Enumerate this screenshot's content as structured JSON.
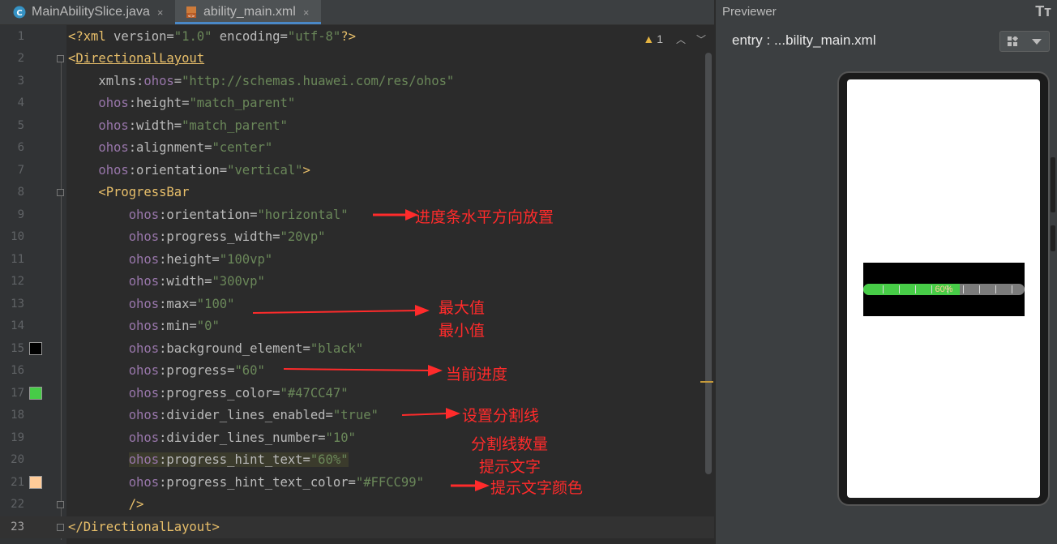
{
  "tabs": [
    {
      "label": "MainAbilitySlice.java",
      "icon": "java-class-icon",
      "close": "×",
      "active": false
    },
    {
      "label": "ability_main.xml",
      "icon": "xml-file-icon",
      "close": "×",
      "active": true
    }
  ],
  "editor": {
    "warning_count": "1",
    "lines": [
      {
        "n": "1",
        "tokens": [
          [
            "punct",
            "<?"
          ],
          [
            "tag",
            "xml "
          ],
          [
            "attr",
            "version"
          ],
          [
            "attr",
            "="
          ],
          [
            "val",
            "\"1.0\""
          ],
          [
            "attr",
            " encoding"
          ],
          [
            "attr",
            "="
          ],
          [
            "val",
            "\"utf-8\""
          ],
          [
            "punct",
            "?>"
          ]
        ]
      },
      {
        "n": "2",
        "tokens": [
          [
            "punct",
            "<"
          ],
          [
            "taglink",
            "DirectionalLayout"
          ]
        ]
      },
      {
        "n": "3",
        "tokens": [
          [
            "attr",
            "    xmlns"
          ],
          [
            "attr",
            ":"
          ],
          [
            "ns",
            "ohos"
          ],
          [
            "attr",
            "="
          ],
          [
            "val",
            "\"http://schemas.huawei.com/res/ohos\""
          ]
        ]
      },
      {
        "n": "4",
        "tokens": [
          [
            "ns",
            "    ohos"
          ],
          [
            "attr",
            ":height="
          ],
          [
            "val",
            "\"match_parent\""
          ]
        ]
      },
      {
        "n": "5",
        "tokens": [
          [
            "ns",
            "    ohos"
          ],
          [
            "attr",
            ":width="
          ],
          [
            "val",
            "\"match_parent\""
          ]
        ]
      },
      {
        "n": "6",
        "tokens": [
          [
            "ns",
            "    ohos"
          ],
          [
            "attr",
            ":alignment="
          ],
          [
            "val",
            "\"center\""
          ]
        ]
      },
      {
        "n": "7",
        "tokens": [
          [
            "ns",
            "    ohos"
          ],
          [
            "attr",
            ":orientation="
          ],
          [
            "val",
            "\"vertical\""
          ],
          [
            "punct",
            ">"
          ]
        ]
      },
      {
        "n": "8",
        "tokens": [
          [
            "punct",
            "    <"
          ],
          [
            "tag",
            "ProgressBar"
          ]
        ]
      },
      {
        "n": "9",
        "tokens": [
          [
            "ns",
            "        ohos"
          ],
          [
            "attr",
            ":orientation="
          ],
          [
            "val",
            "\"horizontal\""
          ]
        ]
      },
      {
        "n": "10",
        "tokens": [
          [
            "ns",
            "        ohos"
          ],
          [
            "attr",
            ":progress_width="
          ],
          [
            "val",
            "\"20vp\""
          ]
        ]
      },
      {
        "n": "11",
        "tokens": [
          [
            "ns",
            "        ohos"
          ],
          [
            "attr",
            ":height="
          ],
          [
            "val",
            "\"100vp\""
          ]
        ]
      },
      {
        "n": "12",
        "tokens": [
          [
            "ns",
            "        ohos"
          ],
          [
            "attr",
            ":width="
          ],
          [
            "val",
            "\"300vp\""
          ]
        ]
      },
      {
        "n": "13",
        "tokens": [
          [
            "ns",
            "        ohos"
          ],
          [
            "attr",
            ":max="
          ],
          [
            "val",
            "\"100\""
          ]
        ]
      },
      {
        "n": "14",
        "tokens": [
          [
            "ns",
            "        ohos"
          ],
          [
            "attr",
            ":min="
          ],
          [
            "val",
            "\"0\""
          ]
        ]
      },
      {
        "n": "15",
        "tokens": [
          [
            "ns",
            "        ohos"
          ],
          [
            "attr",
            ":background_element="
          ],
          [
            "val",
            "\"black\""
          ]
        ]
      },
      {
        "n": "16",
        "tokens": [
          [
            "ns",
            "        ohos"
          ],
          [
            "attr",
            ":progress="
          ],
          [
            "val",
            "\"60\""
          ]
        ]
      },
      {
        "n": "17",
        "tokens": [
          [
            "ns",
            "        ohos"
          ],
          [
            "attr",
            ":progress_color="
          ],
          [
            "val",
            "\"#47CC47\""
          ]
        ]
      },
      {
        "n": "18",
        "tokens": [
          [
            "ns",
            "        ohos"
          ],
          [
            "attr",
            ":divider_lines_enabled="
          ],
          [
            "val",
            "\"true\""
          ]
        ]
      },
      {
        "n": "19",
        "tokens": [
          [
            "ns",
            "        ohos"
          ],
          [
            "attr",
            ":divider_lines_number="
          ],
          [
            "val",
            "\"10\""
          ]
        ]
      },
      {
        "n": "20",
        "tokens": [
          [
            "attr",
            "        "
          ],
          [
            "ns",
            "ohos"
          ],
          [
            "attr",
            ":progress_hint_text="
          ],
          [
            "val",
            "\"60%\""
          ]
        ]
      },
      {
        "n": "21",
        "tokens": [
          [
            "ns",
            "        ohos"
          ],
          [
            "attr",
            ":progress_hint_text_color="
          ],
          [
            "val",
            "\"#FFCC99\""
          ]
        ]
      },
      {
        "n": "22",
        "tokens": [
          [
            "punct",
            "        />"
          ]
        ]
      },
      {
        "n": "23",
        "tokens": [
          [
            "punct",
            "</"
          ],
          [
            "tag",
            "DirectionalLayout"
          ],
          [
            "punct",
            ">"
          ]
        ]
      }
    ],
    "swatches": [
      {
        "line": "15",
        "color": "#000000"
      },
      {
        "line": "17",
        "color": "#47CC47"
      },
      {
        "line": "21",
        "color": "#FFCC99"
      }
    ]
  },
  "annotations": {
    "orientation": "进度条水平方向放置",
    "max": "最大值",
    "min": "最小值",
    "progress": "当前进度",
    "divider_enabled": "设置分割线",
    "divider_number": "分割线数量",
    "hint_text": "提示文字",
    "hint_color": "提示文字颜色"
  },
  "previewer": {
    "title": "Previewer",
    "font_icon": "Tт",
    "file_label": "entry : ...bility_main.xml",
    "progress": {
      "value": 60,
      "max": 100,
      "min": 0,
      "divider_lines": 10,
      "hint": "60%",
      "hint_color": "#FFCC99",
      "progress_color": "#47CC47",
      "background": "#000000"
    }
  }
}
